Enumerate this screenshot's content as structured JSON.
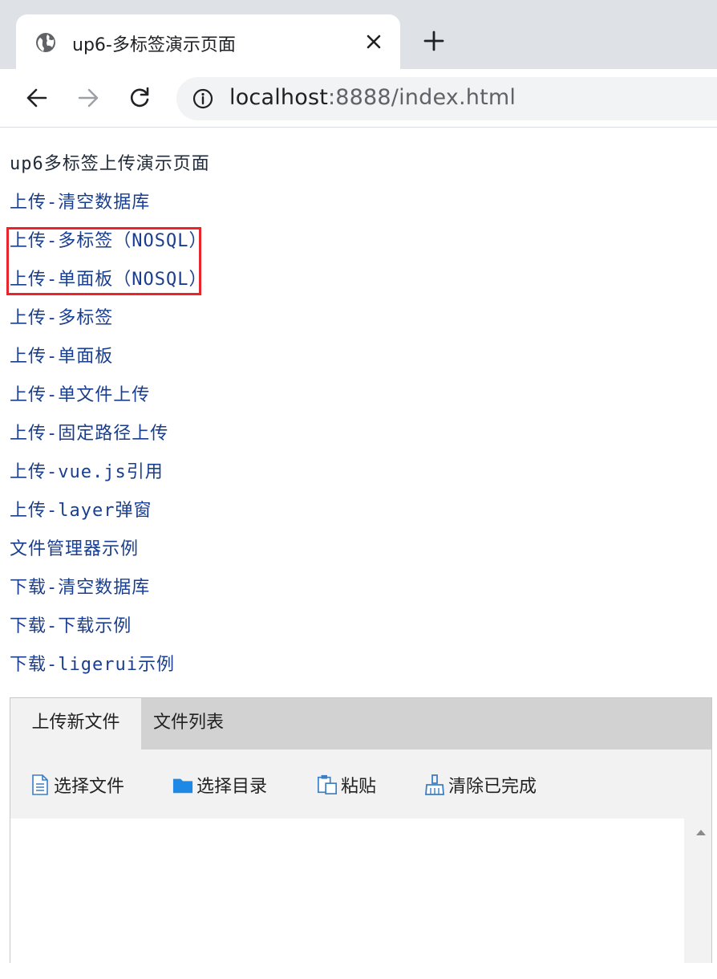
{
  "browser": {
    "tab_title": "up6-多标签演示页面",
    "url_host": "localhost",
    "url_rest": ":8888/index.html"
  },
  "page": {
    "heading": "up6多标签上传演示页面",
    "links": [
      "上传-清空数据库",
      "上传-多标签（NOSQL）",
      "上传-单面板（NOSQL）",
      "上传-多标签",
      "上传-单面板",
      "上传-单文件上传",
      "上传-固定路径上传",
      "上传-vue.js引用",
      "上传-layer弹窗",
      "文件管理器示例",
      "下载-清空数据库",
      "下载-下载示例",
      "下载-ligerui示例"
    ]
  },
  "uploader": {
    "tabs": [
      "上传新文件",
      "文件列表"
    ],
    "buttons": {
      "select_file": "选择文件",
      "select_folder": "选择目录",
      "paste": "粘贴",
      "clear_done": "清除已完成"
    }
  },
  "colors": {
    "link": "#1a3e8f",
    "highlight_box": "#e8252b",
    "folder_icon": "#1e88e5"
  }
}
